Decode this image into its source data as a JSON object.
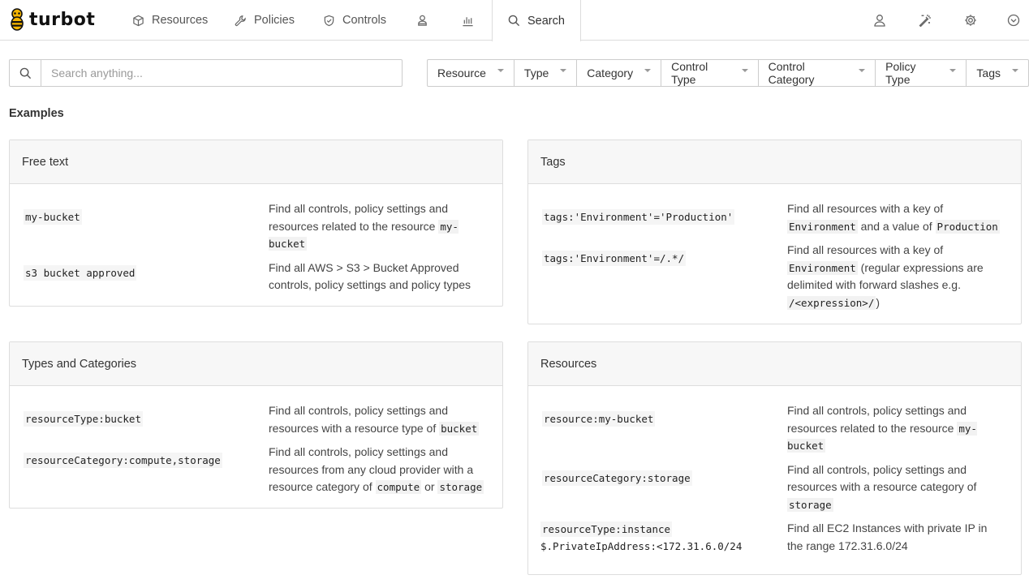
{
  "brand": {
    "name": "turbot"
  },
  "nav": {
    "items": [
      {
        "label": "Resources",
        "icon": "cube-icon"
      },
      {
        "label": "Policies",
        "icon": "wrench-icon"
      },
      {
        "label": "Controls",
        "icon": "shield-check-icon"
      },
      {
        "label": "",
        "icon": "person-badge-icon"
      },
      {
        "label": "",
        "icon": "bar-chart-icon"
      },
      {
        "label": "Search",
        "icon": "search-icon",
        "active": true
      }
    ],
    "right_icons": [
      "user-icon",
      "magic-wand-icon",
      "gear-icon",
      "chevron-down-circle-icon"
    ]
  },
  "search": {
    "placeholder": "Search anything...",
    "value": ""
  },
  "filters": [
    "Resource",
    "Type",
    "Category",
    "Control Type",
    "Control Category",
    "Policy Type",
    "Tags"
  ],
  "examples_title": "Examples",
  "cards": {
    "free_text": {
      "title": "Free text",
      "rows": [
        {
          "code": "my-bucket",
          "desc_pre": "Find all controls, policy settings and resources related to the resource ",
          "desc_code": "my-bucket"
        },
        {
          "code": "s3 bucket approved",
          "desc": "Find all AWS > S3 > Bucket Approved controls, policy settings and policy types"
        }
      ]
    },
    "tags": {
      "title": "Tags",
      "rows": [
        {
          "code": "tags:'Environment'='Production'",
          "desc_a": "Find all resources with a key of ",
          "desc_code_a": "Environment",
          "desc_b": " and a value of ",
          "desc_code_b": "Production"
        },
        {
          "code": "tags:'Environment'=/.*/",
          "desc_a": "Find all resources with a key of ",
          "desc_code_a": "Environment",
          "desc_b": " (regular expressions are delimited with forward slashes e.g. ",
          "desc_code_b": "/<expression>/",
          "desc_c": ")"
        }
      ]
    },
    "types": {
      "title": "Types and Categories",
      "rows": [
        {
          "code": "resourceType:bucket",
          "desc_a": "Find all controls, policy settings and resources with a resource type of ",
          "desc_code_a": "bucket"
        },
        {
          "code": "resourceCategory:compute,storage",
          "desc_a": "Find all controls, policy settings and resources from any cloud provider with a resource category of ",
          "desc_code_a": "compute",
          "desc_b": " or ",
          "desc_code_b": "storage"
        }
      ]
    },
    "resources": {
      "title": "Resources",
      "rows": [
        {
          "code": "resource:my-bucket",
          "desc_a": "Find all controls, policy settings and resources related to the resource ",
          "desc_code_a": "my-bucket"
        },
        {
          "code": "resourceCategory:storage",
          "desc_a": "Find all controls, policy settings and resources with a resource category of ",
          "desc_code_a": "storage"
        },
        {
          "code": "resourceType:instance",
          "code2": "$.PrivateIpAddress:<172.31.6.0/24",
          "desc": "Find all EC2 Instances with private IP in the range 172.31.6.0/24"
        }
      ]
    }
  },
  "colors": {
    "logo_yellow": "#f5b400",
    "border": "#dddddd",
    "header_bg": "#f7f7f7"
  }
}
